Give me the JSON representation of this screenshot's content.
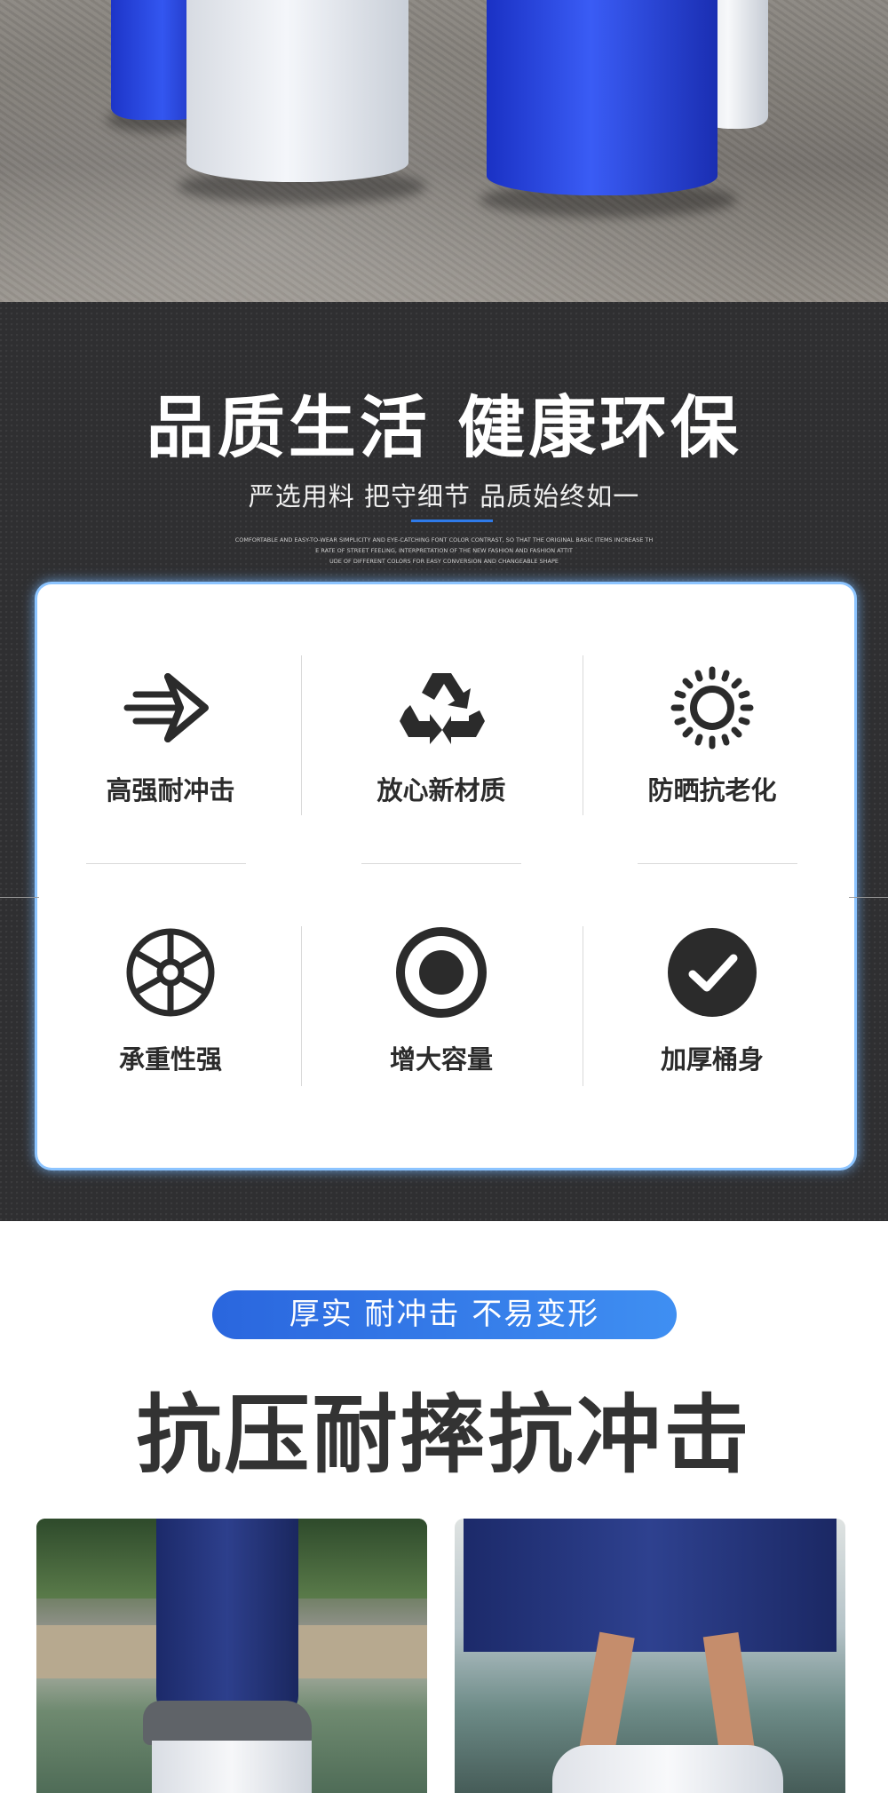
{
  "top_photo": {
    "colors": {
      "blue": "#2f4ee8",
      "white": "#eef0f4"
    }
  },
  "quality": {
    "title": "品质生活 健康环保",
    "subtitle": "严选用料 把守细节 品质始终如一",
    "english_lines": [
      "COMFORTABLE AND EASY-TO-WEAR SIMPLICITY AND EYE-CATCHING FONT COLOR CONTRAST, SO THAT THE ORIGINAL BASIC ITEMS INCREASE TH",
      "E RATE OF STREET FEELING, INTERPRETATION OF THE NEW FASHION AND FASHION ATTIT",
      "UDE OF DIFFERENT COLORS FOR EASY CONVERSION AND CHANGEABLE SHAPE"
    ],
    "features": [
      {
        "icon": "speed-arrow-icon",
        "label": "高强耐冲击"
      },
      {
        "icon": "recycle-icon",
        "label": "放心新材质"
      },
      {
        "icon": "sun-icon",
        "label": "防晒抗老化"
      },
      {
        "icon": "wheel-icon",
        "label": "承重性强"
      },
      {
        "icon": "target-circle-icon",
        "label": "增大容量"
      },
      {
        "icon": "check-circle-icon",
        "label": "加厚桶身"
      }
    ],
    "accent_color": "#2f7bea"
  },
  "impact": {
    "tag": "厚实 耐冲击 不易变形",
    "title": "抗压耐摔抗冲击"
  }
}
